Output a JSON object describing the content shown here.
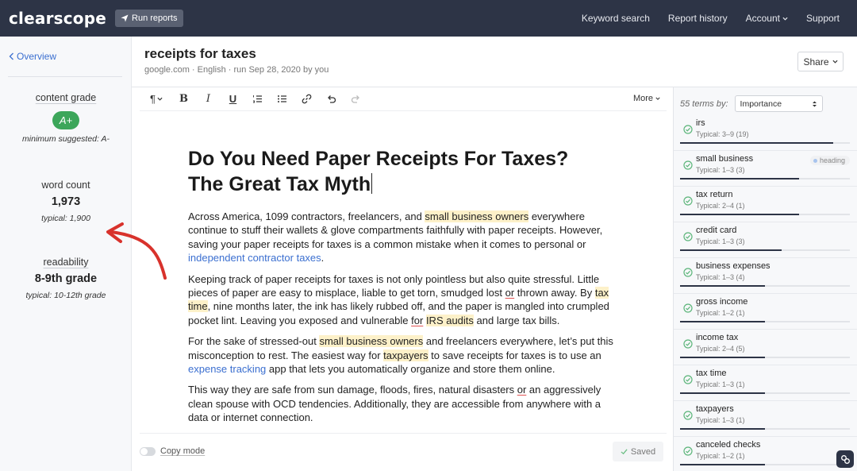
{
  "app": {
    "logo": "clearscope",
    "run_reports_label": "Run reports",
    "nav": {
      "keyword_search": "Keyword search",
      "report_history": "Report history",
      "account": "Account",
      "support": "Support"
    }
  },
  "sidebar": {
    "overview_label": "Overview",
    "content_grade": {
      "label": "content grade",
      "value": "A+",
      "sub": "minimum suggested: A-"
    },
    "word_count": {
      "label": "word count",
      "value": "1,973",
      "sub": "typical: 1,900"
    },
    "readability": {
      "label": "readability",
      "value": "8-9th grade",
      "sub": "typical: 10-12th grade"
    }
  },
  "header": {
    "title": "receipts for taxes",
    "meta": "google.com · English · run Sep 28, 2020 by you",
    "share_label": "Share"
  },
  "toolbar": {
    "paragraph_glyph": "¶",
    "bold_glyph": "B",
    "italic_glyph": "I",
    "underline_glyph": "U",
    "more_label": "More"
  },
  "document": {
    "heading_line1": "Do You Need Paper Receipts For Taxes?",
    "heading_line2": "The Great Tax Myth",
    "p1": {
      "a": "Across America, 1099 contractors, freelancers, and ",
      "hl1": "small business owners",
      "b": " everywhere continue to stuff their wallets & glove compartments faithfully with paper receipts. However, saving your paper receipts for taxes is a common mistake when it comes to personal or ",
      "link": "independent contractor taxes",
      "c": "."
    },
    "p2": {
      "a": "Keeping track of paper receipts for taxes is not only pointless but also quite stressful. Little pieces of paper are easy to misplace, liable to get torn, smudged lost ",
      "sq1": "or",
      "b": " thrown away. By ",
      "hl1": "tax time",
      "c": ", nine months later, the ink has likely rubbed off, and the paper is mangled into crumpled pocket lint. Leaving you exposed and vulnerable ",
      "sq2": "for",
      "d": " ",
      "hl2": "IRS audits",
      "e": " and large tax bills."
    },
    "p3": {
      "a": "For the sake of stressed-out ",
      "hl1": "small business owners",
      "b": " and freelancers everywhere, let’s put this misconception to rest. The easiest way for ",
      "hl2": "taxpayers",
      "c": " to save receipts for taxes is to use an ",
      "link": "expense tracking",
      "d": " app that lets you automatically organize and store them online."
    },
    "p4": {
      "a": "This way they are safe from sun damage, floods, fires, natural disasters ",
      "sq1": "or",
      "b": " an aggressively clean spouse with OCD tendencies. Additionally, they are accessible from anywhere with a data or internet connection."
    }
  },
  "footer": {
    "copy_mode_label": "Copy mode",
    "saved_label": "Saved"
  },
  "terms_panel": {
    "count_label": "55 terms by:",
    "sort_value": "Importance",
    "terms": [
      {
        "name": "irs",
        "typical": "Typical: 3–9 (19)",
        "progress": 0.9
      },
      {
        "name": "small business",
        "typical": "Typical: 1–3 (3)",
        "tag": "heading",
        "progress": 0.7
      },
      {
        "name": "tax return",
        "typical": "Typical: 2–4 (1)",
        "progress": 0.7
      },
      {
        "name": "credit card",
        "typical": "Typical: 1–3 (3)",
        "progress": 0.6
      },
      {
        "name": "business expenses",
        "typical": "Typical: 1–3 (4)",
        "progress": 0.5
      },
      {
        "name": "gross income",
        "typical": "Typical: 1–2 (1)",
        "progress": 0.5
      },
      {
        "name": "income tax",
        "typical": "Typical: 2–4 (5)",
        "progress": 0.5
      },
      {
        "name": "tax time",
        "typical": "Typical: 1–3 (1)",
        "progress": 0.5
      },
      {
        "name": "taxpayers",
        "typical": "Typical: 1–3 (1)",
        "progress": 0.5
      },
      {
        "name": "canceled checks",
        "typical": "Typical: 1–2 (1)",
        "progress": 0.5
      }
    ]
  },
  "colors": {
    "nav_bg": "#2d3446",
    "grade_green": "#3ca65a",
    "link_blue": "#3b6fd0",
    "highlight": "#fdf1c9",
    "arrow_red": "#d8322c"
  }
}
